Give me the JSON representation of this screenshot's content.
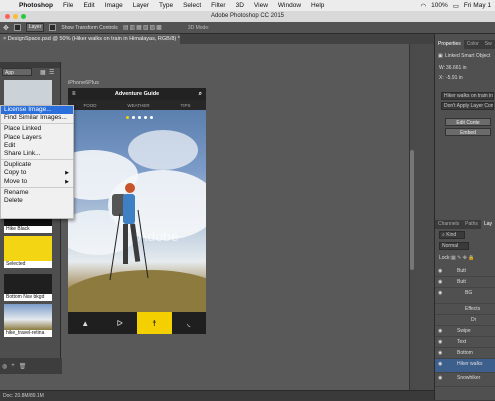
{
  "menubar": {
    "app": "Photoshop",
    "items": [
      "File",
      "Edit",
      "Image",
      "Layer",
      "Type",
      "Select",
      "Filter",
      "3D",
      "View",
      "Window",
      "Help"
    ],
    "battery": "100%",
    "clock": "Fri May 1"
  },
  "window": {
    "title": "Adobe Photoshop CC 2015"
  },
  "options": {
    "layer_select": "Layer",
    "show_transform": "Show Transform Controls",
    "mode_3d": "3D Mode:"
  },
  "document": {
    "tab": "DesignSpace.psd @ 50% (Hiker walks on train in Himalayas, RGB/8) *",
    "status": "Doc: 20.8M/89.1M"
  },
  "artboard": {
    "label": "iPhone6Plus",
    "app_title": "Adventure Guide",
    "tabs": [
      "FOOD",
      "WEATHER",
      "TIPS"
    ],
    "watermark": "Adobe",
    "nav_icons": [
      "tent-icon",
      "bike-icon",
      "hiker-icon",
      "shoe-icon"
    ]
  },
  "context_menu": {
    "items": [
      {
        "label": "License Image...",
        "selected": true
      },
      {
        "label": "Find Similar Images..."
      },
      {
        "label": "Place Linked"
      },
      {
        "label": "Place Layers"
      },
      {
        "label": "Edit"
      },
      {
        "label": "Share Link..."
      },
      {
        "label": "Duplicate"
      },
      {
        "label": "Copy to",
        "submenu": true
      },
      {
        "label": "Move to",
        "submenu": true
      },
      {
        "label": "Rename"
      },
      {
        "label": "Delete"
      }
    ]
  },
  "library": {
    "dropdown": "App",
    "items": [
      "Hike Black",
      "Selected",
      "Bottom Nav bkgd",
      "hike_travel-retina"
    ]
  },
  "properties": {
    "tabs": [
      "Properties",
      "Color",
      "Sw"
    ],
    "title": "Linked Smart Object",
    "w_label": "W:",
    "w_value": "36.661 in",
    "x_label": "X:",
    "x_value": "-5.91 in",
    "layer_name": "Hiker walks on train in",
    "comp": "Don't Apply Layer Comp",
    "btn1": "Edit Conte",
    "btn2": "Embed"
  },
  "layers_panel": {
    "tabs": [
      "Channels",
      "Paths",
      "Lay"
    ],
    "kind": "Kind",
    "blend": "Normal",
    "lock": "Lock:",
    "items": [
      "Butt",
      "Butt",
      "BG",
      "Effects",
      "Dr",
      "Swipe",
      "Text",
      "Bottom",
      "Hiker walks",
      "Snowhiker"
    ]
  }
}
